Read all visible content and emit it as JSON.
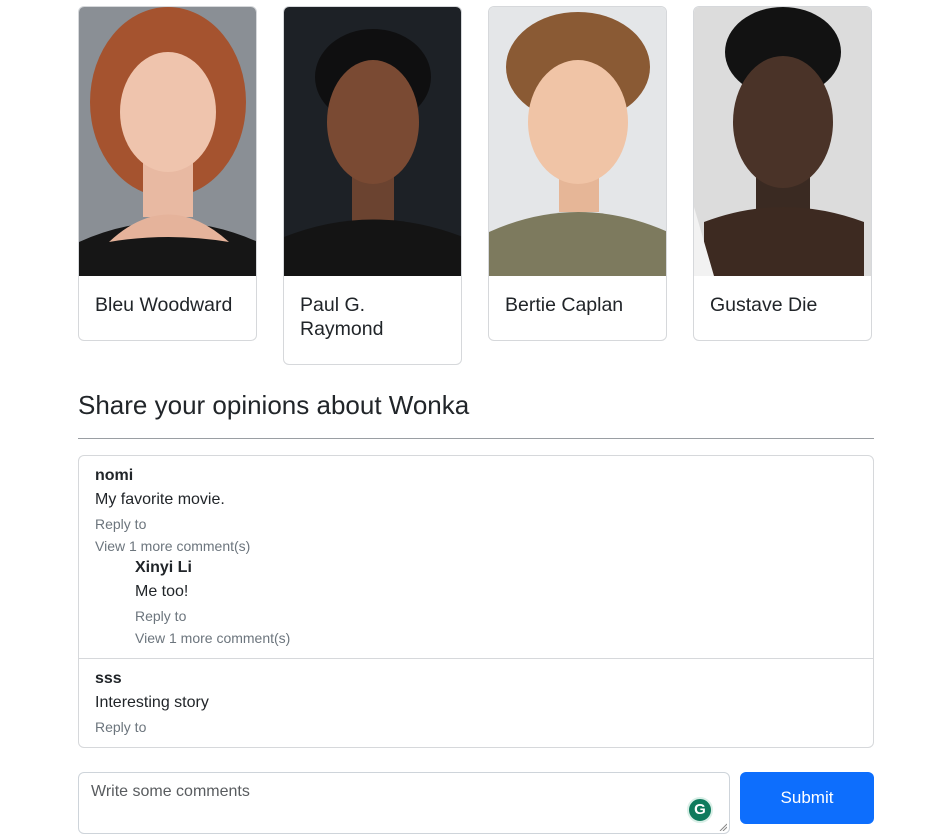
{
  "cast": [
    {
      "name": "Bleu Woodward"
    },
    {
      "name": "Paul G. Raymond"
    },
    {
      "name": "Bertie Caplan"
    },
    {
      "name": "Gustave Die"
    }
  ],
  "section": {
    "heading": "Share your opinions about Wonka"
  },
  "comments": [
    {
      "author": "nomi",
      "text": "My favorite movie.",
      "reply_label": "Reply to",
      "more_label": "View 1 more comment(s)",
      "replies": [
        {
          "author": "Xinyi Li",
          "text": "Me too!",
          "reply_label": "Reply to",
          "more_label": "View 1 more comment(s)"
        }
      ]
    },
    {
      "author": "sss",
      "text": "Interesting story",
      "reply_label": "Reply to"
    }
  ],
  "form": {
    "placeholder": "Write some comments",
    "submit_label": "Submit"
  },
  "grammarly_glyph": "G",
  "colors": {
    "accent": "#0d6efd",
    "muted": "#6c757d",
    "border": "#d6d8db"
  }
}
